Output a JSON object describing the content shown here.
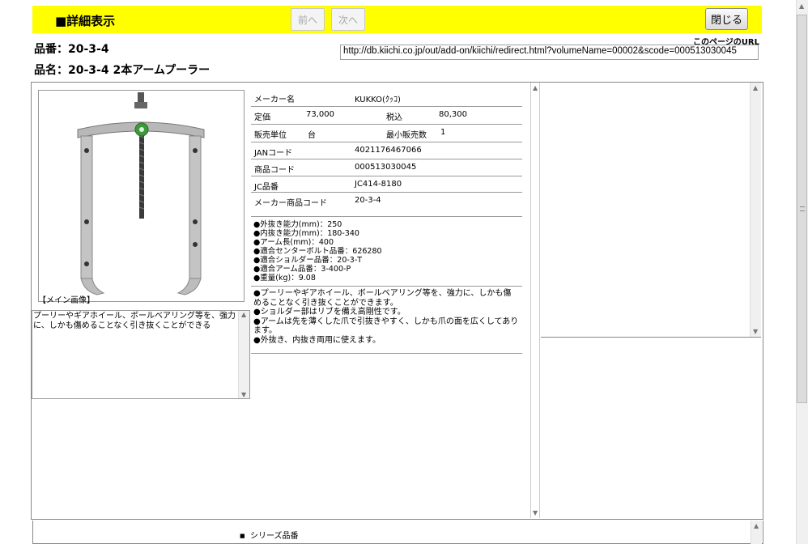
{
  "header": {
    "title": "■詳細表示",
    "prev_label": "前へ",
    "next_label": "次へ",
    "close_label": "閉じる"
  },
  "product": {
    "hinban": "品番：20-3-4",
    "hinmei": "品名：20-3-4 2本アームプーラー"
  },
  "url": {
    "label": "このページのURL",
    "value": "http://db.kiichi.co.jp/out/add-on/kiichi/redirect.html?volumeName=00002&scode=000513030045"
  },
  "image": {
    "caption": "【メイン画像】",
    "description": "プーリーやギアホイール、ボールベアリング等を、強力に、しかも傷めることなく引き抜くことができる"
  },
  "spec": {
    "maker_label": "メーカー名",
    "maker_value": "KUKKO(ｸｯｺ)",
    "price_label": "定価",
    "price_value": "73,000",
    "tax_label": "税込",
    "tax_value": "80,300",
    "unit_label": "販売単位",
    "unit_value": "台",
    "min_label": "最小販売数",
    "min_value": "1",
    "jan_label": "JANコード",
    "jan_value": "4021176467066",
    "code_label": "商品コード",
    "code_value": "000513030045",
    "jc_label": "JC品番",
    "jc_value": "JC414-8180",
    "maker_code_label": "メーカー商品コード",
    "maker_code_value": "20-3-4"
  },
  "features": [
    "●外抜き能力(mm)：250",
    "●内抜き能力(mm)：180-340",
    "●アーム長(mm)：400",
    "●適合センターボルト品番：626280",
    "●適合ショルダー品番：20-3-T",
    "●適合アーム品番：3-400-P",
    "●重量(kg)：9.08"
  ],
  "notes": [
    "●プーリーやギアホイール、ボールベアリング等を、強力に、しかも傷めることなく引き抜くことができます。",
    "●ショルダー部はリブを備え高剛性です。",
    "●アームは先を薄くした爪で引抜きやすく、しかも爪の面を広くしてあります。",
    "●外抜き、内抜き両用に使えます。"
  ],
  "bottom": {
    "series_label": "シリーズ品番"
  },
  "colors": {
    "header_bg": "#ffff00"
  }
}
